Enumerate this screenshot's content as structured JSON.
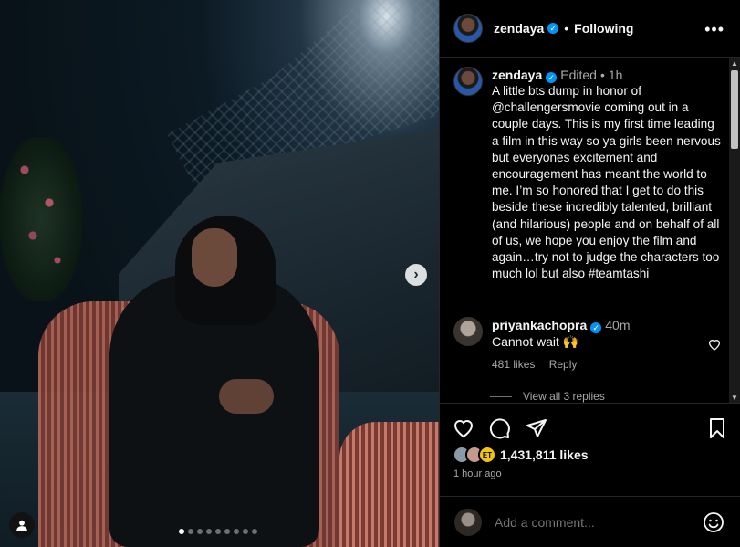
{
  "post": {
    "carousel": {
      "slide_count": 9,
      "active_slide": 1
    }
  },
  "header": {
    "username": "zendaya",
    "separator": "•",
    "follow_status": "Following",
    "more_icon": "more-dots-icon"
  },
  "caption": {
    "username": "zendaya",
    "edited": "Edited",
    "dot": "•",
    "time": "1h",
    "text": "A little bts dump in honor of @challengersmovie coming out in a couple days. This is my first time leading a film in this way so ya girls been nervous but everyones excitement and encouragement has meant the world to me. I’m so honored that I get to do this beside these incredibly talented, brilliant (and hilarious) people and on behalf of all of us, we hope you enjoy the film and again…try not to judge the characters too much lol but also #teamtashi"
  },
  "comment": {
    "username": "priyankachopra",
    "time": "40m",
    "text": "Cannot wait 🙌",
    "likes": "481 likes",
    "reply": "Reply"
  },
  "view_replies": "View all 3 replies",
  "actions": {
    "likes": "1,431,811 likes",
    "time_ago": "1 hour ago",
    "liker_badge": "ET"
  },
  "add_comment": {
    "placeholder": "Add a comment..."
  },
  "colors": {
    "verified": "#0095f6",
    "background": "#000000",
    "muted": "#a8a8a8"
  }
}
